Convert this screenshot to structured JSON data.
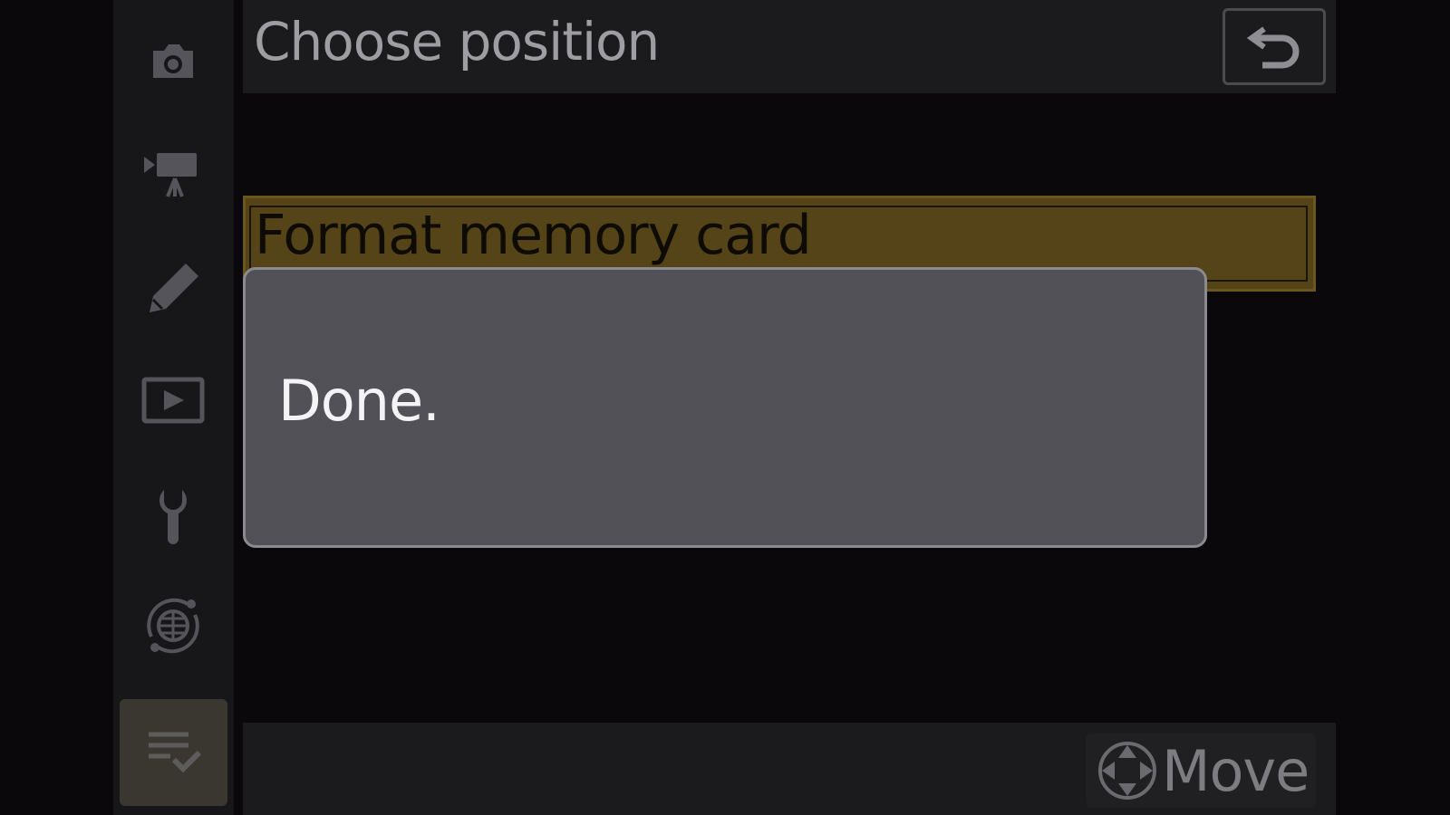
{
  "header": {
    "title": "Choose position",
    "back_icon": "return-arrow-icon"
  },
  "sidebar": {
    "items": [
      {
        "icon": "camera-icon",
        "active": false
      },
      {
        "icon": "movie-camera-icon",
        "active": false
      },
      {
        "icon": "pencil-icon",
        "active": false
      },
      {
        "icon": "playback-icon",
        "active": false
      },
      {
        "icon": "wrench-icon",
        "active": false
      },
      {
        "icon": "network-globe-icon",
        "active": false
      },
      {
        "icon": "my-menu-icon",
        "active": true
      }
    ]
  },
  "menu": {
    "selected_item": "Format memory card"
  },
  "dialog": {
    "message": "Done."
  },
  "footer": {
    "move_icon": "multi-selector-icon",
    "move_label": "Move"
  },
  "colors": {
    "background": "#0a080b",
    "sidebar": "#171619",
    "highlight": "#544417",
    "dialog": "#535158",
    "dialog_text": "#f4f4f6",
    "muted_text": "#9e9da2"
  }
}
